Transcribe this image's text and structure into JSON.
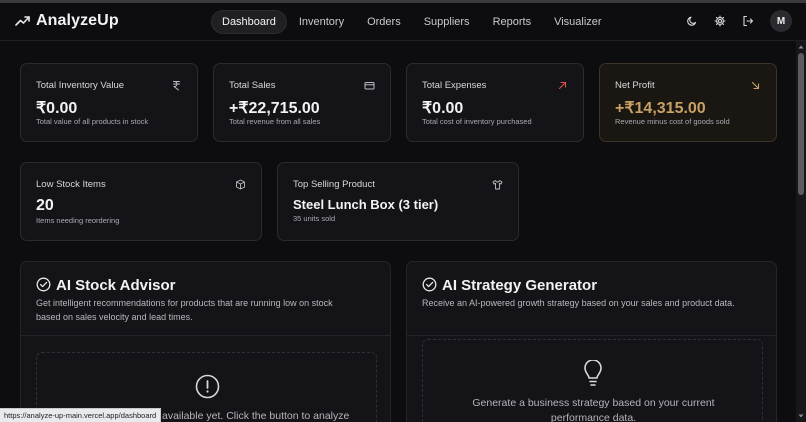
{
  "app": {
    "name": "AnalyzeUp"
  },
  "nav": {
    "items": [
      {
        "label": "Dashboard",
        "active": true
      },
      {
        "label": "Inventory"
      },
      {
        "label": "Orders"
      },
      {
        "label": "Suppliers"
      },
      {
        "label": "Reports"
      },
      {
        "label": "Visualizer"
      }
    ],
    "avatar_initial": "M"
  },
  "stats": [
    {
      "label": "Total Inventory Value",
      "value": "₹0.00",
      "sub": "Total value of all products in stock",
      "icon": "rupee-icon"
    },
    {
      "label": "Total Sales",
      "value": "+₹22,715.00",
      "sub": "Total revenue from all sales",
      "icon": "credit-card-icon"
    },
    {
      "label": "Total Expenses",
      "value": "₹0.00",
      "sub": "Total cost of inventory purchased",
      "icon": "arrow-up-right-icon",
      "icon_color": "#e0524a"
    },
    {
      "label": "Net Profit",
      "value": "+₹14,315.00",
      "sub": "Revenue minus cost of goods sold",
      "icon": "arrow-down-right-icon",
      "accent": "#c9a064"
    }
  ],
  "low_stock": {
    "label": "Low Stock Items",
    "value": "20",
    "sub": "Items needing reordering",
    "icon": "package-icon"
  },
  "top_product": {
    "label": "Top Selling Product",
    "value": "Steel Lunch Box (3 tier)",
    "sub": "35 units sold",
    "icon": "shirt-icon"
  },
  "advisor": {
    "title": "AI Stock Advisor",
    "desc_line1": "Get intelligent recommendations for products that are running low on stock",
    "desc_line2": "based on sales velocity and lead times.",
    "empty_text": "available yet. Click the button to analyze"
  },
  "strategy": {
    "title": "AI Strategy Generator",
    "desc": "Receive an AI-powered growth strategy based on your sales and product data.",
    "empty_line1": "Generate a business strategy based on your current",
    "empty_line2": "performance data."
  },
  "status_url": "https://analyze-up-main.vercel.app/dashboard"
}
